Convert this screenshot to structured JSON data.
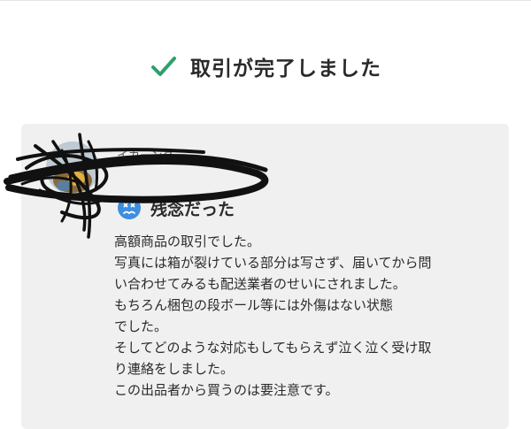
{
  "transaction": {
    "status_text": "取引が完了しました",
    "status_icon": "checkmark-icon",
    "status_color": "#2e9f6e"
  },
  "review": {
    "reviewer_name": "イカーング",
    "rating_icon": "sad-face-icon",
    "rating_label": "残念だった",
    "rating_color": "#3e8ee0",
    "comment_lines": [
      "高額商品の取引でした。",
      "写真には箱が裂けている部分は写さず、届いてから問",
      "い合わせてみるも配送業者のせいにされました。",
      "もちろん梱包の段ボール等には外傷はない状態",
      "でした。",
      "そしてどのような対応もしてもらえず泣く泣く受け取",
      "り連絡をしました。",
      "この出品者から買うのは要注意です。"
    ]
  },
  "colors": {
    "card_background": "#f0f0f0",
    "redaction_ink": "#111111"
  }
}
